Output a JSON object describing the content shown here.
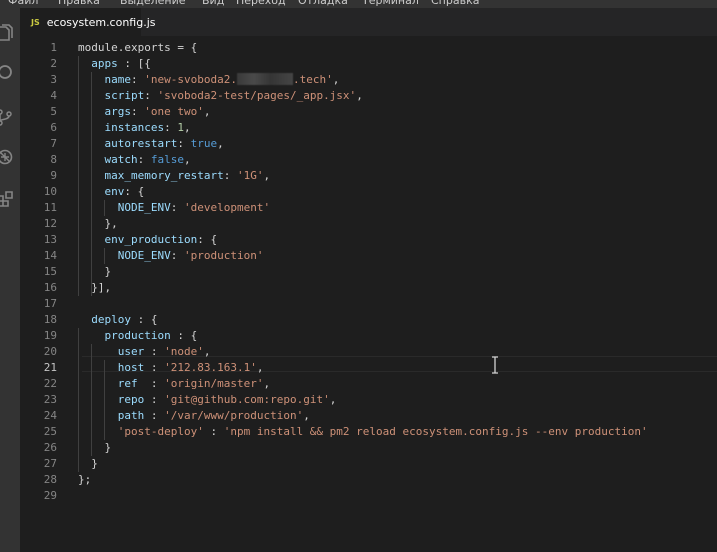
{
  "menu": [
    "Файл",
    "Правка",
    "Выделение",
    "Вид",
    "Переход",
    "Отладка",
    "Терминал",
    "Справка"
  ],
  "activity_icons": [
    "explorer-icon",
    "search-icon",
    "source-control-icon",
    "debug-icon",
    "extensions-icon"
  ],
  "tab": {
    "icon": "JS",
    "label": "ecosystem.config.js"
  },
  "active_line": 21,
  "lines": [
    {
      "n": "1",
      "t": [
        [
          "t-p",
          "module.exports = {"
        ]
      ]
    },
    {
      "n": "2",
      "t": [
        [
          "t-p",
          "  "
        ],
        [
          "t-key",
          "apps"
        ],
        [
          "t-p",
          " : [{"
        ]
      ]
    },
    {
      "n": "3",
      "t": [
        [
          "t-p",
          "    "
        ],
        [
          "t-key",
          "name"
        ],
        [
          "t-p",
          ": "
        ],
        [
          "t-str",
          "'new-svoboda2."
        ],
        [
          "redact",
          ""
        ],
        [
          "t-str",
          ".tech'"
        ],
        [
          "t-p",
          ","
        ]
      ]
    },
    {
      "n": "4",
      "t": [
        [
          "t-p",
          "    "
        ],
        [
          "t-key",
          "script"
        ],
        [
          "t-p",
          ": "
        ],
        [
          "t-str",
          "'svoboda2-test/pages/_app.jsx'"
        ],
        [
          "t-p",
          ","
        ]
      ]
    },
    {
      "n": "5",
      "t": [
        [
          "t-p",
          "    "
        ],
        [
          "t-key",
          "args"
        ],
        [
          "t-p",
          ": "
        ],
        [
          "t-str",
          "'one two'"
        ],
        [
          "t-p",
          ","
        ]
      ]
    },
    {
      "n": "6",
      "t": [
        [
          "t-p",
          "    "
        ],
        [
          "t-key",
          "instances"
        ],
        [
          "t-p",
          ": "
        ],
        [
          "t-num",
          "1"
        ],
        [
          "t-p",
          ","
        ]
      ]
    },
    {
      "n": "7",
      "t": [
        [
          "t-p",
          "    "
        ],
        [
          "t-key",
          "autorestart"
        ],
        [
          "t-p",
          ": "
        ],
        [
          "t-kw",
          "true"
        ],
        [
          "t-p",
          ","
        ]
      ]
    },
    {
      "n": "8",
      "t": [
        [
          "t-p",
          "    "
        ],
        [
          "t-key",
          "watch"
        ],
        [
          "t-p",
          ": "
        ],
        [
          "t-kw",
          "false"
        ],
        [
          "t-p",
          ","
        ]
      ]
    },
    {
      "n": "9",
      "t": [
        [
          "t-p",
          "    "
        ],
        [
          "t-key",
          "max_memory_restart"
        ],
        [
          "t-p",
          ": "
        ],
        [
          "t-str",
          "'1G'"
        ],
        [
          "t-p",
          ","
        ]
      ]
    },
    {
      "n": "10",
      "t": [
        [
          "t-p",
          "    "
        ],
        [
          "t-key",
          "env"
        ],
        [
          "t-p",
          ": {"
        ]
      ]
    },
    {
      "n": "11",
      "t": [
        [
          "t-p",
          "      "
        ],
        [
          "t-key",
          "NODE_ENV"
        ],
        [
          "t-p",
          ": "
        ],
        [
          "t-str",
          "'development'"
        ]
      ]
    },
    {
      "n": "12",
      "t": [
        [
          "t-p",
          "    },"
        ]
      ]
    },
    {
      "n": "13",
      "t": [
        [
          "t-p",
          "    "
        ],
        [
          "t-key",
          "env_production"
        ],
        [
          "t-p",
          ": {"
        ]
      ]
    },
    {
      "n": "14",
      "t": [
        [
          "t-p",
          "      "
        ],
        [
          "t-key",
          "NODE_ENV"
        ],
        [
          "t-p",
          ": "
        ],
        [
          "t-str",
          "'production'"
        ]
      ]
    },
    {
      "n": "15",
      "t": [
        [
          "t-p",
          "    }"
        ]
      ]
    },
    {
      "n": "16",
      "t": [
        [
          "t-p",
          "  }],"
        ]
      ]
    },
    {
      "n": "17",
      "t": []
    },
    {
      "n": "18",
      "t": [
        [
          "t-p",
          "  "
        ],
        [
          "t-key",
          "deploy"
        ],
        [
          "t-p",
          " : {"
        ]
      ]
    },
    {
      "n": "19",
      "t": [
        [
          "t-p",
          "    "
        ],
        [
          "t-key",
          "production"
        ],
        [
          "t-p",
          " : {"
        ]
      ]
    },
    {
      "n": "20",
      "t": [
        [
          "t-p",
          "      "
        ],
        [
          "t-key",
          "user"
        ],
        [
          "t-p",
          " : "
        ],
        [
          "t-str",
          "'node'"
        ],
        [
          "t-p",
          ","
        ]
      ]
    },
    {
      "n": "21",
      "t": [
        [
          "t-p",
          "      "
        ],
        [
          "t-key",
          "host"
        ],
        [
          "t-p",
          " : "
        ],
        [
          "t-str",
          "'212.83.163.1'"
        ],
        [
          "t-p",
          ","
        ]
      ]
    },
    {
      "n": "22",
      "t": [
        [
          "t-p",
          "      "
        ],
        [
          "t-key",
          "ref"
        ],
        [
          "t-p",
          "  : "
        ],
        [
          "t-str",
          "'origin/master'"
        ],
        [
          "t-p",
          ","
        ]
      ]
    },
    {
      "n": "23",
      "t": [
        [
          "t-p",
          "      "
        ],
        [
          "t-key",
          "repo"
        ],
        [
          "t-p",
          " : "
        ],
        [
          "t-str",
          "'git@github.com:repo.git'"
        ],
        [
          "t-p",
          ","
        ]
      ]
    },
    {
      "n": "24",
      "t": [
        [
          "t-p",
          "      "
        ],
        [
          "t-key",
          "path"
        ],
        [
          "t-p",
          " : "
        ],
        [
          "t-str",
          "'/var/www/production'"
        ],
        [
          "t-p",
          ","
        ]
      ]
    },
    {
      "n": "25",
      "t": [
        [
          "t-p",
          "      "
        ],
        [
          "t-str",
          "'post-deploy'"
        ],
        [
          "t-p",
          " : "
        ],
        [
          "t-str",
          "'npm install && pm2 reload ecosystem.config.js --env production'"
        ]
      ]
    },
    {
      "n": "26",
      "t": [
        [
          "t-p",
          "    }"
        ]
      ]
    },
    {
      "n": "27",
      "t": [
        [
          "t-p",
          "  }"
        ]
      ]
    },
    {
      "n": "28",
      "t": [
        [
          "t-p",
          "};"
        ]
      ]
    },
    {
      "n": "29",
      "t": []
    }
  ],
  "colors": {
    "background": "#1e1e1e",
    "string": "#ce9178",
    "property": "#9cdcfe",
    "keyword": "#569cd6",
    "number": "#b5cea8",
    "line_number": "#858585",
    "js_icon": "#cbcb41"
  }
}
